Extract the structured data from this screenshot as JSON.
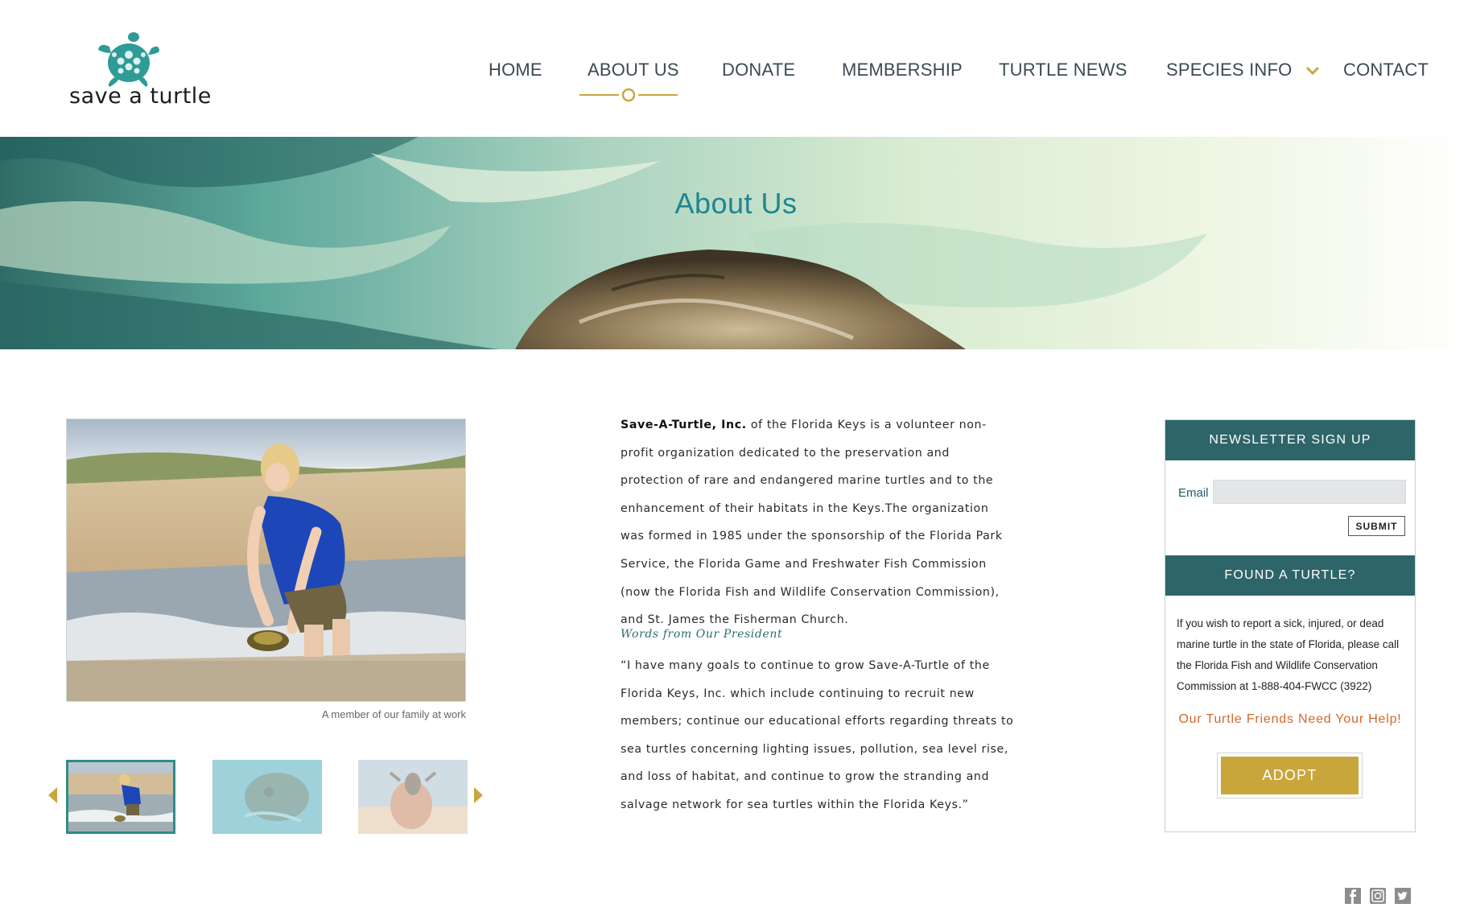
{
  "logo": {
    "text": "save a turtle",
    "icon": "turtle-logo-icon"
  },
  "nav": {
    "items": [
      {
        "label": "HOME"
      },
      {
        "label": "ABOUT US"
      },
      {
        "label": "DONATE"
      },
      {
        "label": "MEMBERSHIP"
      },
      {
        "label": "TURTLE NEWS"
      },
      {
        "label": "SPECIES INFO"
      },
      {
        "label": "CONTACT"
      }
    ],
    "active": "ABOUT US",
    "accent_color": "#c9a640"
  },
  "hero": {
    "title": "About Us"
  },
  "gallery": {
    "caption": "A member of our family at work",
    "thumbnails": 3,
    "active_index": 0
  },
  "content": {
    "org_name": "Save-A-Turtle, Inc.",
    "intro_rest": " of the Florida Keys is a volunteer non-profit organization dedicated to the preservation and protection of rare and endangered marine turtles and to the enhancement of their habitats in the Keys.The organization was formed in 1985 under the sponsorship of the Florida Park Service, the Florida Game and Freshwater Fish Commission (now the Florida Fish and Wildlife Conservation Commission), and St. James the Fisherman Church.",
    "president_heading": "Words from Our President",
    "quote": "“I have many goals to continue to grow Save-A-Turtle of the Florida Keys, Inc. which include continuing to recruit new members; continue our educational efforts regarding threats to sea turtles concerning lighting issues, pollution, sea level rise, and loss of habitat, and continue to grow the stranding and salvage network for sea turtles within the Florida Keys.”"
  },
  "sidebar": {
    "newsletter_title": "NEWSLETTER SIGN UP",
    "email_label": "Email",
    "email_value": "",
    "submit_label": "SUBMIT",
    "found_title": "FOUND A TURTLE?",
    "found_text": "If you wish to report a sick, injured, or dead marine turtle in the state of Florida, please call the Florida Fish and Wildlife Conservation Commission at 1-888-404-FWCC (3922)",
    "help_text": "Our Turtle Friends Need Your Help!",
    "adopt_label": "ADOPT",
    "header_color": "#2e6569",
    "button_color": "#c9a63b"
  },
  "social": {
    "icons": [
      "facebook-icon",
      "instagram-icon",
      "twitter-icon"
    ]
  }
}
